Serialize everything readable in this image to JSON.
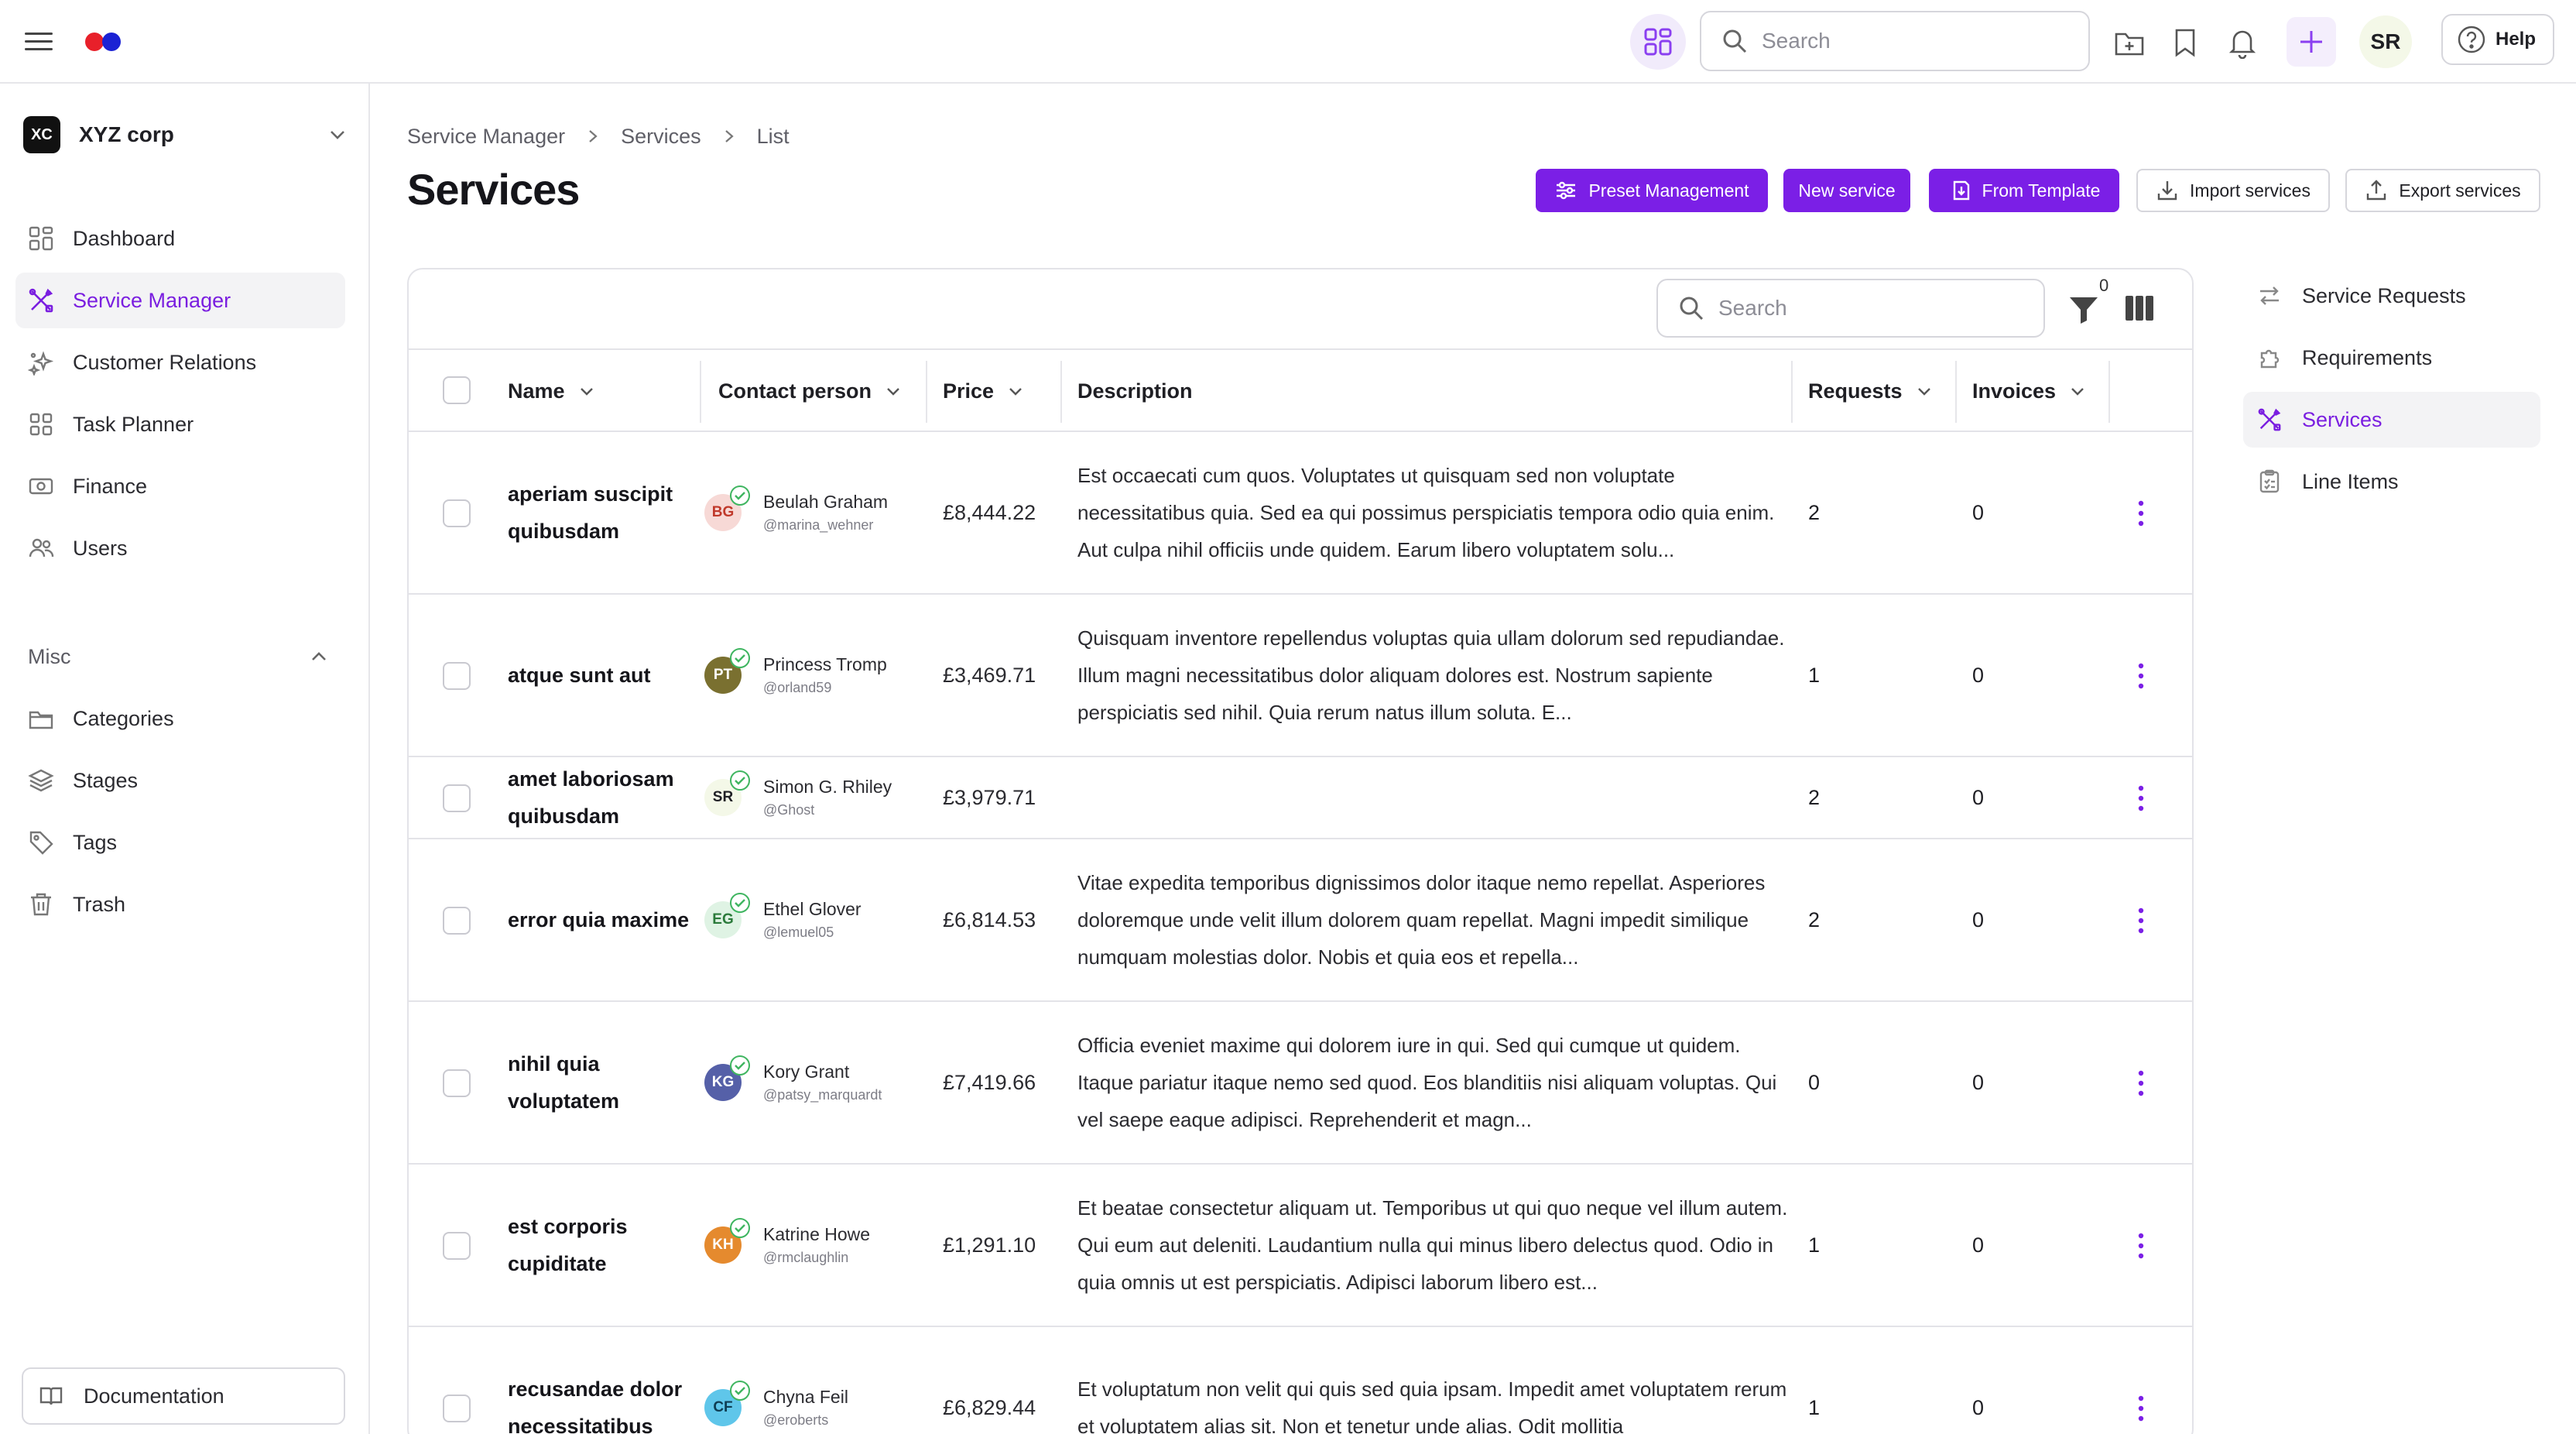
{
  "header": {
    "search_placeholder": "Search",
    "user_initials": "SR",
    "help_label": "Help"
  },
  "sidebar": {
    "org": {
      "badge": "XC",
      "name": "XYZ corp"
    },
    "items": [
      {
        "label": "Dashboard",
        "icon": "dashboard-icon",
        "active": false
      },
      {
        "label": "Service Manager",
        "icon": "tools-icon",
        "active": true
      },
      {
        "label": "Customer Relations",
        "icon": "sparkle-icon",
        "active": false
      },
      {
        "label": "Task Planner",
        "icon": "grid-icon",
        "active": false
      },
      {
        "label": "Finance",
        "icon": "banknote-icon",
        "active": false
      },
      {
        "label": "Users",
        "icon": "users-icon",
        "active": false
      }
    ],
    "misc_label": "Misc",
    "misc_items": [
      {
        "label": "Categories",
        "icon": "folder-icon"
      },
      {
        "label": "Stages",
        "icon": "layers-icon"
      },
      {
        "label": "Tags",
        "icon": "tag-icon"
      },
      {
        "label": "Trash",
        "icon": "trash-icon"
      }
    ],
    "documentation_label": "Documentation"
  },
  "breadcrumb": [
    "Service Manager",
    "Services",
    "List"
  ],
  "page_title": "Services",
  "actions": {
    "preset": "Preset Management",
    "new_service": "New service",
    "from_template": "From Template",
    "import": "Import services",
    "export": "Export services"
  },
  "table": {
    "search_placeholder": "Search",
    "filter_count": "0",
    "columns": {
      "name": "Name",
      "contact": "Contact person",
      "price": "Price",
      "description": "Description",
      "requests": "Requests",
      "invoices": "Invoices"
    },
    "rows": [
      {
        "name": "aperiam suscipit quibusdam",
        "initials": "BG",
        "avatar_bg": "#f7d9d6",
        "avatar_fg": "#c0392b",
        "contact": "Beulah Graham",
        "handle": "@marina_wehner",
        "price": "£8,444.22",
        "description": "Est occaecati cum quos. Voluptates ut quisquam sed non voluptate necessitatibus quia. Sed ea qui possimus perspiciatis tempora odio quia enim. Aut culpa nihil officiis unde quidem. Earum libero voluptatem solu...",
        "requests": "2",
        "invoices": "0"
      },
      {
        "name": "atque sunt aut",
        "initials": "PT",
        "avatar_bg": "#7a7030",
        "avatar_fg": "#ffffff",
        "contact": "Princess Tromp",
        "handle": "@orland59",
        "price": "£3,469.71",
        "description": "Quisquam inventore repellendus voluptas quia ullam dolorum sed repudiandae. Illum magni necessitatibus dolor aliquam dolores est. Nostrum sapiente perspiciatis sed nihil. Quia rerum natus illum soluta. E...",
        "requests": "1",
        "invoices": "0"
      },
      {
        "name": "amet laboriosam quibusdam",
        "initials": "SR",
        "avatar_bg": "#f4f8e8",
        "avatar_fg": "#1f1f24",
        "contact": "Simon G. Rhiley",
        "handle": "@Ghost",
        "price": "£3,979.71",
        "description": "",
        "requests": "2",
        "invoices": "0"
      },
      {
        "name": "error quia maxime",
        "initials": "EG",
        "avatar_bg": "#dff3e4",
        "avatar_fg": "#2a7a3a",
        "contact": "Ethel Glover",
        "handle": "@lemuel05",
        "price": "£6,814.53",
        "description": "Vitae expedita temporibus dignissimos dolor itaque nemo repellat. Asperiores doloremque unde velit illum dolorem quam repellat. Magni impedit similique numquam molestias dolor. Nobis et quia eos et repella...",
        "requests": "2",
        "invoices": "0"
      },
      {
        "name": "nihil quia voluptatem",
        "initials": "KG",
        "avatar_bg": "#5560a8",
        "avatar_fg": "#ffffff",
        "contact": "Kory Grant",
        "handle": "@patsy_marquardt",
        "price": "£7,419.66",
        "description": "Officia eveniet maxime qui dolorem iure in qui. Sed qui cumque ut quidem. Itaque pariatur itaque nemo sed quod. Eos blanditiis nisi aliquam voluptas. Qui vel saepe eaque adipisci. Reprehenderit et magn...",
        "requests": "0",
        "invoices": "0"
      },
      {
        "name": "est corporis cupiditate",
        "initials": "KH",
        "avatar_bg": "#e58a2e",
        "avatar_fg": "#ffffff",
        "contact": "Katrine Howe",
        "handle": "@rmclaughlin",
        "price": "£1,291.10",
        "description": "Et beatae consectetur aliquam ut. Temporibus ut qui quo neque vel illum autem. Qui eum aut deleniti. Laudantium nulla qui minus libero delectus quod. Odio in quia omnis ut est perspiciatis. Adipisci laborum libero est...",
        "requests": "1",
        "invoices": "0"
      },
      {
        "name": "recusandae dolor necessitatibus",
        "initials": "CF",
        "avatar_bg": "#5fc6ea",
        "avatar_fg": "#0f3d52",
        "contact": "Chyna Feil",
        "handle": "@eroberts",
        "price": "£6,829.44",
        "description": "Et voluptatum non velit qui quis sed quia ipsam. Impedit amet voluptatem rerum et voluptatem alias sit. Non et tenetur unde alias. Odit mollitia",
        "requests": "1",
        "invoices": "0"
      }
    ]
  },
  "right_nav": [
    {
      "label": "Service Requests",
      "icon": "swap-icon",
      "active": false
    },
    {
      "label": "Requirements",
      "icon": "puzzle-icon",
      "active": false
    },
    {
      "label": "Services",
      "icon": "tools-icon",
      "active": true
    },
    {
      "label": "Line Items",
      "icon": "checklist-icon",
      "active": false
    }
  ],
  "colors": {
    "accent": "#7b1fe6",
    "active_text": "#7a1ee0",
    "border": "#e3e3e8"
  }
}
